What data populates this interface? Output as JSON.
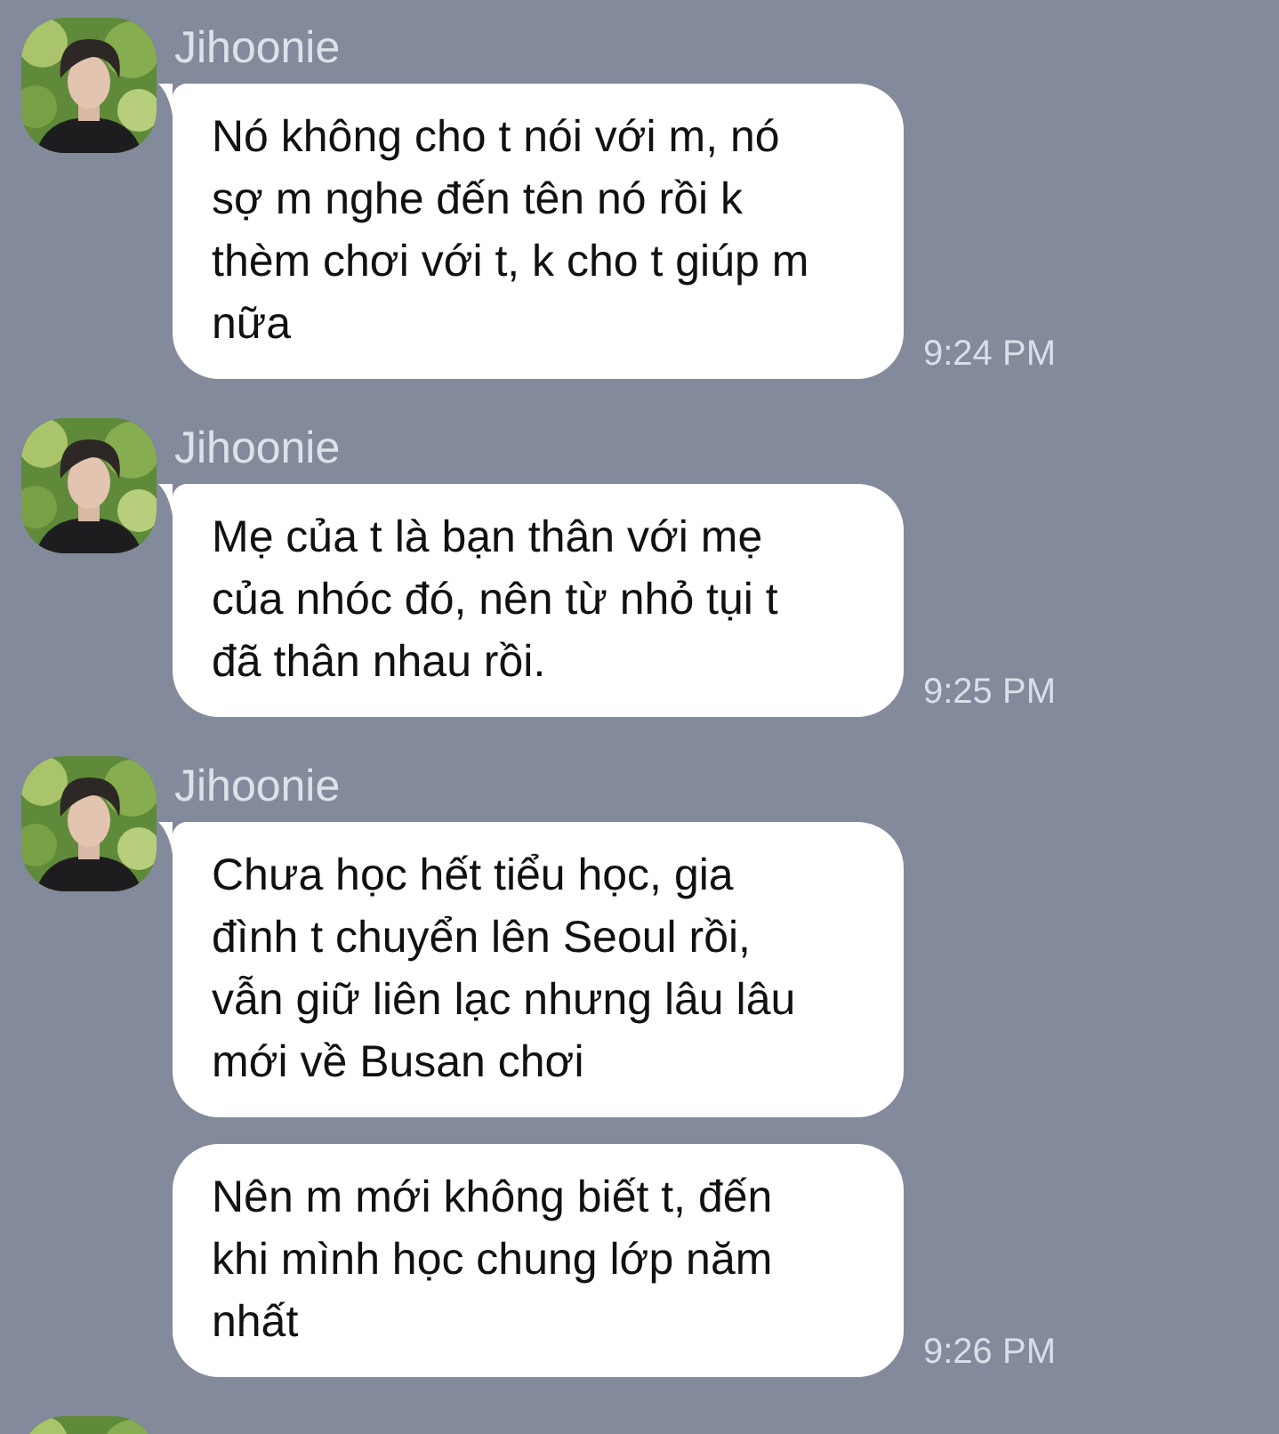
{
  "groups": [
    {
      "kind": "full",
      "sender": "Jihoonie",
      "messages": [
        {
          "text": "Nó không cho t nói với m, nó sợ m nghe đến tên nó rồi k thèm chơi với t, k cho t giúp m nữa",
          "time": "9:24 PM"
        }
      ]
    },
    {
      "kind": "full",
      "sender": "Jihoonie",
      "messages": [
        {
          "text": "Mẹ của t là bạn thân với mẹ của nhóc đó, nên từ nhỏ tụi t đã thân nhau rồi.",
          "time": "9:25 PM"
        }
      ]
    },
    {
      "kind": "full",
      "sender": "Jihoonie",
      "messages": [
        {
          "text": "Chưa học hết tiểu học, gia đình t chuyển lên Seoul rồi, vẫn giữ liên lạc nhưng lâu lâu mới về Busan chơi"
        },
        {
          "text": "Nên m mới không biết t, đến khi mình học chung lớp năm nhất",
          "time": "9:26 PM"
        }
      ]
    },
    {
      "kind": "clipped"
    }
  ]
}
